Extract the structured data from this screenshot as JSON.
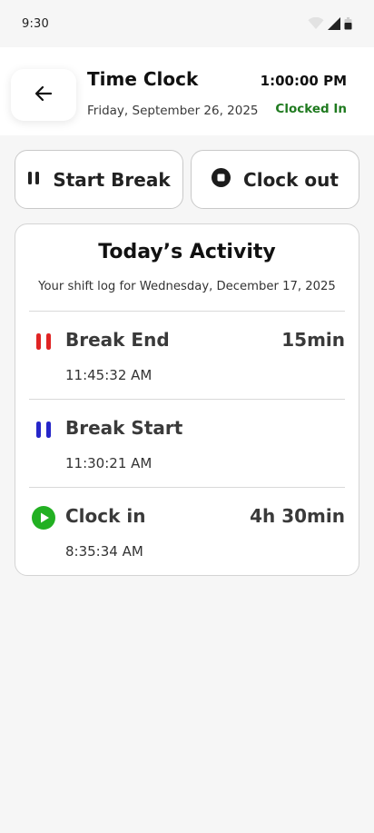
{
  "status_bar": {
    "time": "9:30"
  },
  "header": {
    "title": "Time Clock",
    "date": "Friday, September 26, 2025",
    "clock": "1:00:00 PM",
    "status": "Clocked In",
    "status_color": "#1f7a1f"
  },
  "actions": {
    "start_break": {
      "label": "Start Break",
      "icon": "pause-icon"
    },
    "clock_out": {
      "label": "Clock out",
      "icon": "stop-icon"
    }
  },
  "activity": {
    "title": "Today’s Activity",
    "subtitle": "Your shift log for Wednesday, December 17, 2025",
    "entries": [
      {
        "label": "Break End",
        "time": "11:45:32 AM",
        "duration": "15min",
        "icon": "pause-icon",
        "icon_color": "#e02424"
      },
      {
        "label": "Break Start",
        "time": "11:30:21 AM",
        "duration": "",
        "icon": "pause-icon",
        "icon_color": "#2626c9"
      },
      {
        "label": "Clock in",
        "time": "8:35:34 AM",
        "duration": "4h 30min",
        "icon": "play-circle-icon",
        "icon_color": "#22b022"
      }
    ]
  }
}
